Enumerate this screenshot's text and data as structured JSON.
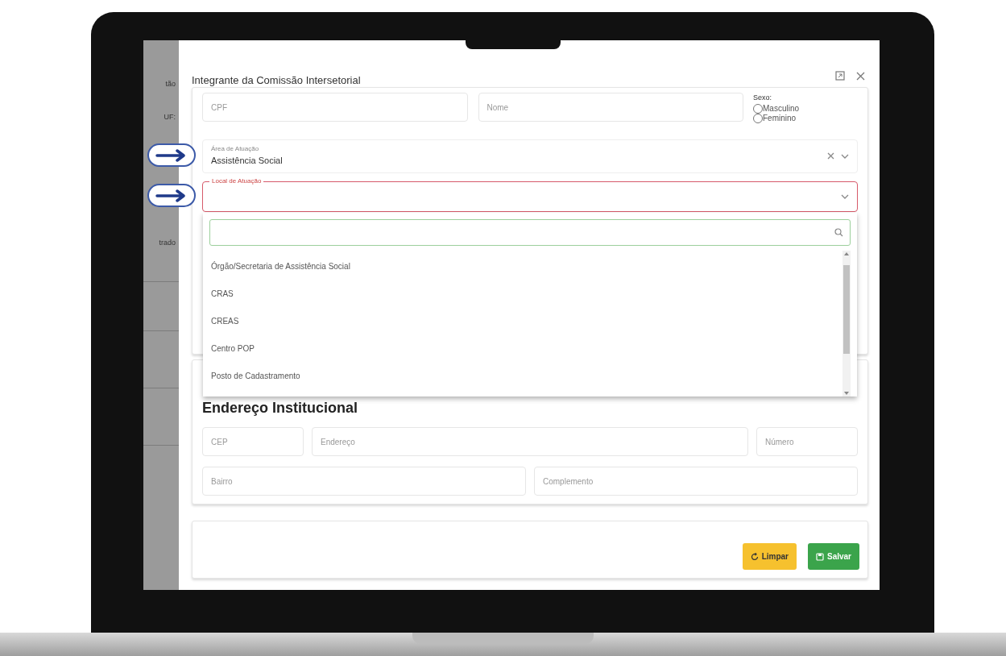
{
  "background_page": {
    "texts": [
      "tão",
      "UF:",
      "trado"
    ]
  },
  "modal": {
    "title": "Integrante da Comissão Intersetorial"
  },
  "identificacao": {
    "cpf": {
      "placeholder": "CPF"
    },
    "nome": {
      "placeholder": "Nome"
    },
    "sexo": {
      "label": "Sexo:",
      "options": [
        {
          "label": "Masculino",
          "selected": false
        },
        {
          "label": "Feminino",
          "selected": false
        }
      ]
    }
  },
  "area_de_atuacao": {
    "label": "Área de Atuação",
    "value": "Assistência Social"
  },
  "local_de_atuacao": {
    "label": "Local de Atuação",
    "invalid": true,
    "expanded": true,
    "options": [
      {
        "label": "Órgão/Secretaria de Assistência Social",
        "selected": false
      },
      {
        "label": "CRAS",
        "selected": false
      },
      {
        "label": "CREAS",
        "selected": false
      },
      {
        "label": "Centro POP",
        "selected": false
      },
      {
        "label": "Posto de Cadastramento",
        "selected": false
      }
    ]
  },
  "endereco": {
    "title": "Endereço Institucional",
    "rows": [
      [
        {
          "placeholder": "CEP"
        },
        {
          "placeholder": "Endereço"
        },
        {
          "placeholder": "Número"
        }
      ],
      [
        {
          "placeholder": "Bairro"
        },
        {
          "placeholder": "Complemento"
        }
      ]
    ]
  },
  "buttons": [
    {
      "label": "Limpar",
      "kind": "clear"
    },
    {
      "label": "Salvar",
      "kind": "save"
    }
  ]
}
